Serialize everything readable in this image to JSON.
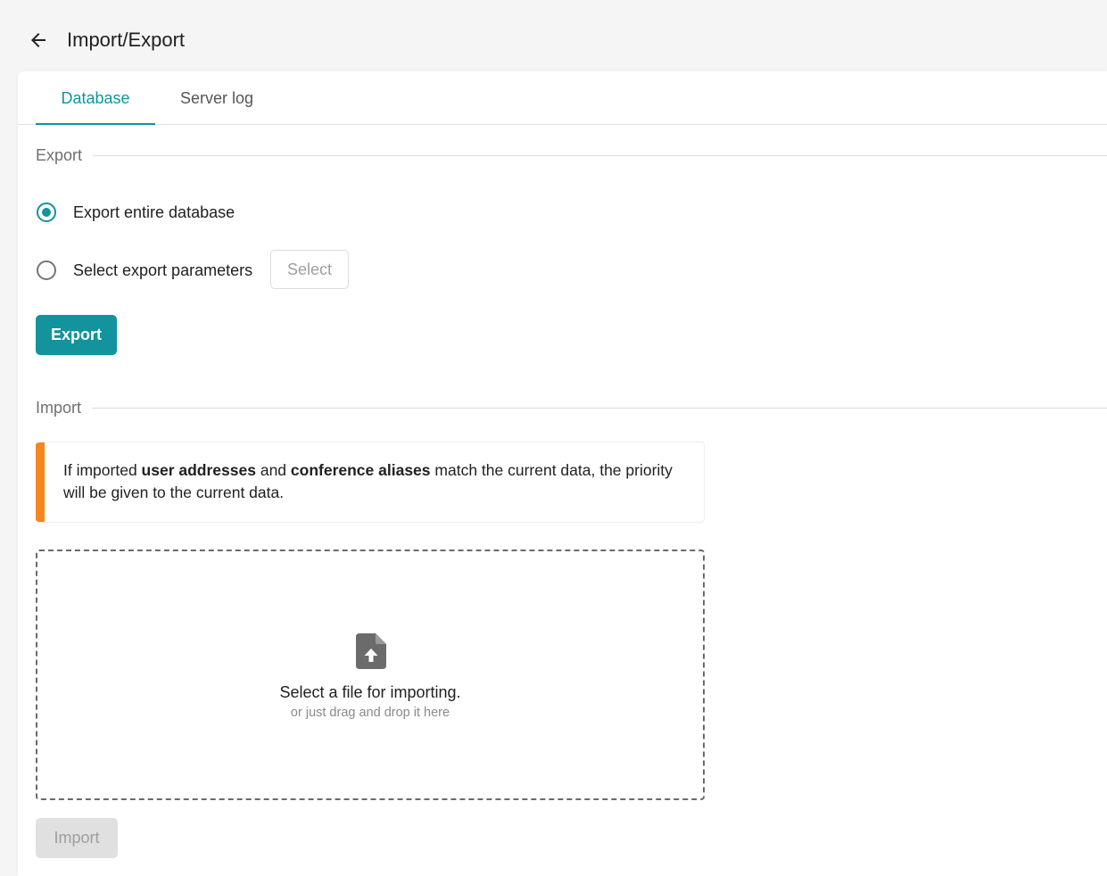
{
  "header": {
    "title": "Import/Export",
    "back_icon": "arrow-left-icon"
  },
  "tabs": [
    {
      "label": "Database",
      "active": true
    },
    {
      "label": "Server log",
      "active": false
    }
  ],
  "export": {
    "section_title": "Export",
    "options": [
      {
        "label": "Export entire database",
        "checked": true
      },
      {
        "label": "Select export parameters",
        "checked": false
      }
    ],
    "select_label": "Select",
    "button_label": "Export"
  },
  "import": {
    "section_title": "Import",
    "notice": {
      "part1": "If imported ",
      "bold1": "user addresses",
      "part2": " and ",
      "bold2": "conference aliases",
      "part3": " match the current data, the priority will be given to the current data."
    },
    "dropzone": {
      "icon": "file-upload-icon",
      "title": "Select a file for importing.",
      "subtitle": "or just drag and drop it here"
    },
    "button_label": "Import",
    "button_disabled": true
  },
  "colors": {
    "accent": "#12939e",
    "warning": "#f7861c",
    "disabled_bg": "#e0e0e0"
  }
}
